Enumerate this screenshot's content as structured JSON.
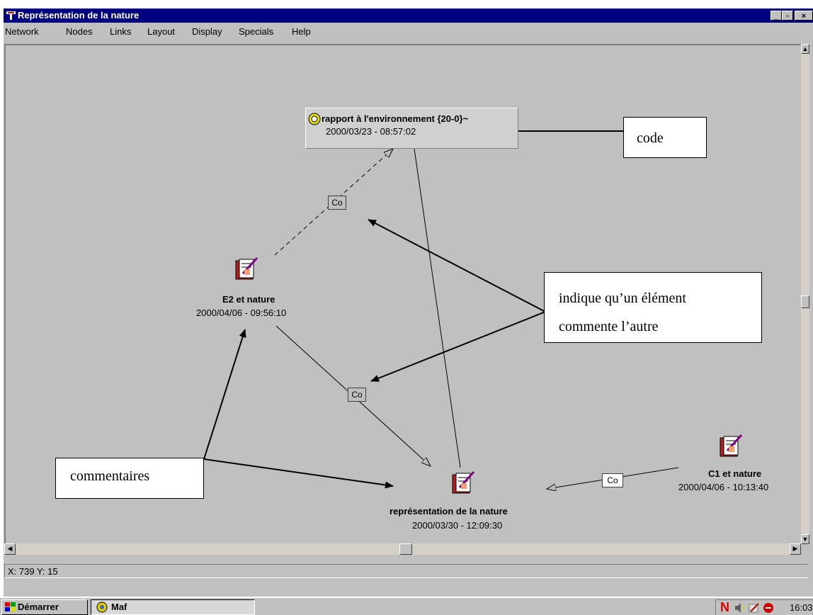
{
  "window": {
    "title": "Représentation de la nature",
    "controls": {
      "minimize": "_",
      "maximize": "▫",
      "close": "×"
    }
  },
  "menu": [
    {
      "label": "Network"
    },
    {
      "label": "Nodes"
    },
    {
      "label": "Links"
    },
    {
      "label": "Layout"
    },
    {
      "label": "Display"
    },
    {
      "label": "Specials"
    },
    {
      "label": "Help"
    }
  ],
  "nodes": {
    "code": {
      "title": "rapport à l'environnement {20-0}~",
      "date": "2000/03/23 - 08:57:02",
      "icon": "code-icon"
    },
    "e2": {
      "title": "E2 et nature",
      "date": "2000/04/06 - 09:56:10",
      "icon": "memo-notebook-icon"
    },
    "representation": {
      "title": "représentation de la nature",
      "date": "2000/03/30 - 12:09:30",
      "icon": "memo-notebook-icon"
    },
    "c1": {
      "title": "C1 et nature",
      "date": "2000/04/06 - 10:13:40",
      "icon": "memo-notebook-icon"
    }
  },
  "links": [
    {
      "label": "Co"
    },
    {
      "label": "Co"
    },
    {
      "label": "Co"
    }
  ],
  "callouts": {
    "code": "code",
    "comments_line1": "indique qu’un élément",
    "comments_line2": "commente l’autre",
    "commentaires": "commentaires"
  },
  "status": {
    "coords": "X: 739 Y: 15"
  },
  "taskbar": {
    "start_label": "Démarrer",
    "task_label": "Maf",
    "clock": "16:03"
  },
  "colors": {
    "titlebar": "#000080",
    "canvas": "#c0c0c0",
    "notebook": "#b02020"
  }
}
